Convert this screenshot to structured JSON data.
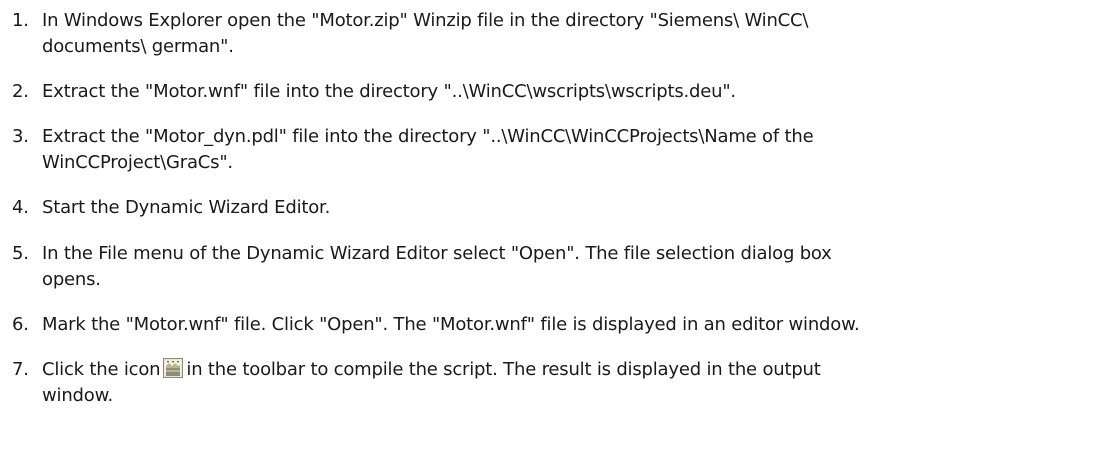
{
  "steps": [
    {
      "number": "1.",
      "lines": [
        "In Windows Explorer open the \"Motor.zip\" Winzip file in the directory \"Siemens\\ WinCC\\",
        "documents\\ german\"."
      ]
    },
    {
      "number": "2.",
      "lines": [
        "Extract the \"Motor.wnf\" file into the directory \"..\\WinCC\\wscripts\\wscripts.deu\"."
      ]
    },
    {
      "number": "3.",
      "lines": [
        "Extract the \"Motor_dyn.pdl\" file into the directory \"..\\WinCC\\WinCCProjects\\Name of the",
        "WinCCProject\\GraCs\"."
      ]
    },
    {
      "number": "4.",
      "lines": [
        "Start the Dynamic Wizard Editor."
      ]
    },
    {
      "number": "5.",
      "lines": [
        "In the File menu of the Dynamic Wizard Editor select \"Open\". The file selection dialog box",
        "opens."
      ]
    },
    {
      "number": "6.",
      "lines": [
        "Mark the \"Motor.wnf\" file. Click \"Open\". The \"Motor.wnf\" file is displayed in an editor window."
      ]
    },
    {
      "number": "7.",
      "line1_before_icon": "Click the icon",
      "line1_after_icon": "in the toolbar to compile the script. The result is displayed in the output",
      "line2": "window.",
      "icon": "compile-script-icon"
    }
  ]
}
